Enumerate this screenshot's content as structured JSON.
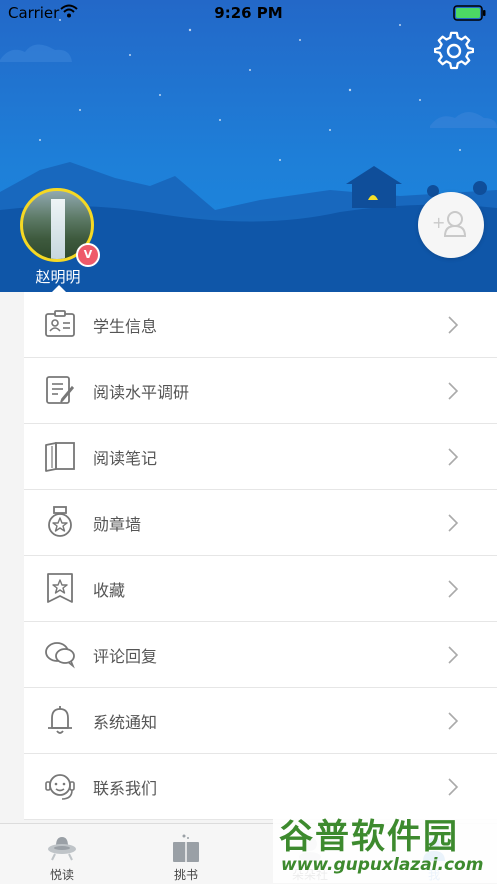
{
  "status_bar": {
    "carrier": "Carrier",
    "time": "9:26 PM"
  },
  "profile": {
    "name": "赵明明",
    "vip_badge": "V"
  },
  "menu": [
    {
      "label": "学生信息",
      "icon": "id-card-icon"
    },
    {
      "label": "阅读水平调研",
      "icon": "survey-icon"
    },
    {
      "label": "阅读笔记",
      "icon": "book-notes-icon"
    },
    {
      "label": "勋章墙",
      "icon": "medal-icon"
    },
    {
      "label": "收藏",
      "icon": "star-bookmark-icon"
    },
    {
      "label": "评论回复",
      "icon": "chat-bubbles-icon"
    },
    {
      "label": "系统通知",
      "icon": "bell-icon"
    },
    {
      "label": "联系我们",
      "icon": "headset-icon"
    }
  ],
  "tabs": [
    {
      "label": "悦读",
      "icon": "ufo-icon"
    },
    {
      "label": "挑书",
      "icon": "book-stack-icon"
    },
    {
      "label": "朵朵社",
      "icon": "community-icon"
    },
    {
      "label": "我",
      "icon": "profile-icon"
    }
  ],
  "watermark": {
    "title": "谷普软件园",
    "url": "www.gupuxlazai.com"
  },
  "colors": {
    "header_blue": "#1e7fd8",
    "avatar_border": "#f5d824",
    "badge_red": "#ee5a6a",
    "watermark_green": "#3d8a2e"
  }
}
